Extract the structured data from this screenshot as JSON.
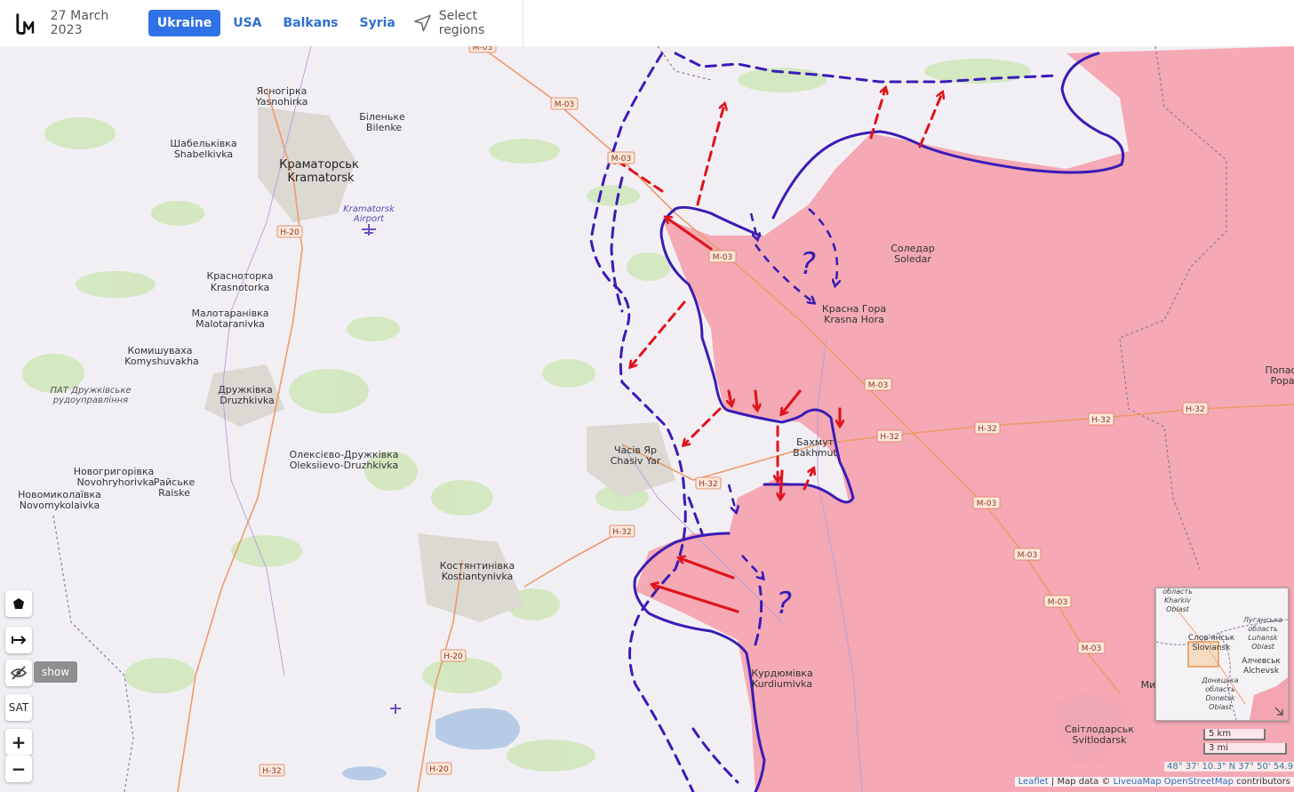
{
  "header": {
    "date": "27 March 2023",
    "tabs": [
      "Ukraine",
      "USA",
      "Balkans",
      "Syria"
    ],
    "active_tab": "Ukraine",
    "select_regions": "Select regions"
  },
  "colors": {
    "accent": "#2f72e6",
    "occupied_area": "#f3a4b0",
    "front_line": "#3a1cb5",
    "attack_arrows": "#e0131b",
    "roads": "#f09a6a"
  },
  "icons": [
    "logo-icon",
    "navigation-arrow-icon",
    "polygon-icon",
    "measure-icon",
    "eye-off-icon",
    "airport-icon"
  ],
  "map": {
    "cities": [
      {
        "name_uk": "Краматорськ",
        "name_en": "Kramatorsk"
      },
      {
        "name_uk": "Бахмут",
        "name_en": "Bakhmut"
      },
      {
        "name_uk": "Соледар",
        "name_en": "Soledar"
      },
      {
        "name_uk": "Красна Гора",
        "name_en": "Krasna Hora"
      },
      {
        "name_uk": "Часів Яр",
        "name_en": "Chasiv Yar"
      },
      {
        "name_uk": "Костянтинівка",
        "name_en": "Kostiantynivka"
      },
      {
        "name_uk": "Дружківка",
        "name_en": "Druzhkivka"
      },
      {
        "name_uk": "Ясногірка",
        "name_en": "Yasnohirka"
      },
      {
        "name_uk": "Біленьке",
        "name_en": "Bilenke"
      },
      {
        "name_uk": "Шабельківка",
        "name_en": "Shabelkivka"
      },
      {
        "name_uk": "Красноторка",
        "name_en": "Krasnotorka"
      },
      {
        "name_uk": "Малотаранівка",
        "name_en": "Malotaranivka"
      },
      {
        "name_uk": "Комишуваха",
        "name_en": "Komyshuvakha"
      },
      {
        "name_uk": "Новогригорівка",
        "name_en": "Novohryhorivka"
      },
      {
        "name_uk": "Райське",
        "name_en": "Raiske"
      },
      {
        "name_uk": "Новомиколаївка",
        "name_en": "Novomykolaivka"
      },
      {
        "name_uk": "Олексієво-Дружківка",
        "name_en": "Oleksiievo-Druzhkivka"
      },
      {
        "name_uk": "Курдюмівка",
        "name_en": "Kurdiumivka"
      },
      {
        "name_uk": "Світлодарськ",
        "name_en": "Svitlodarsk"
      }
    ],
    "poi": {
      "airport_uk": "Kramatorsk",
      "airport_en": "Airport",
      "mine_1": "ПАТ Дружківське",
      "mine_2": "рудоуправління",
      "edge_1": "Попас",
      "edge_2": "Рора",
      "edge_3": "Ми"
    },
    "roads": [
      "M-03",
      "H-20",
      "H-32"
    ],
    "question_marks": [
      "?",
      "?"
    ]
  },
  "controls": {
    "show": "show",
    "sat": "SAT",
    "zoom_in": "+",
    "zoom_out": "−"
  },
  "minimap": {
    "kharkiv_uk": "область",
    "kharkiv_en": "Kharkiv",
    "kharkiv_oblast": "Oblast",
    "luhansk_uk_1": "Луганська",
    "luhansk_uk_2": "область",
    "luhansk_en": "Luhansk",
    "luhansk_oblast": "Oblast",
    "sloviansk_uk": "Слов'янськ",
    "sloviansk_en": "Sloviansk",
    "alchevsk_uk": "Алчевськ",
    "alchevsk_en": "Alchevsk",
    "donetsk_uk_1": "Донецька",
    "donetsk_uk_2": "область",
    "donetsk_en": "Donetsk",
    "donetsk_oblast": "Oblast"
  },
  "scale": {
    "metric": "5 km",
    "imperial": "3 mi"
  },
  "coordinates": "48° 37' 10.3\" N 37° 50' 54.9\" E",
  "attribution": {
    "leaflet": "Leaflet",
    "map_data": " | Map data © ",
    "liveuamap": "LiveuaMap",
    "osm": "OpenStreetMap",
    "contributors": " contributors"
  }
}
